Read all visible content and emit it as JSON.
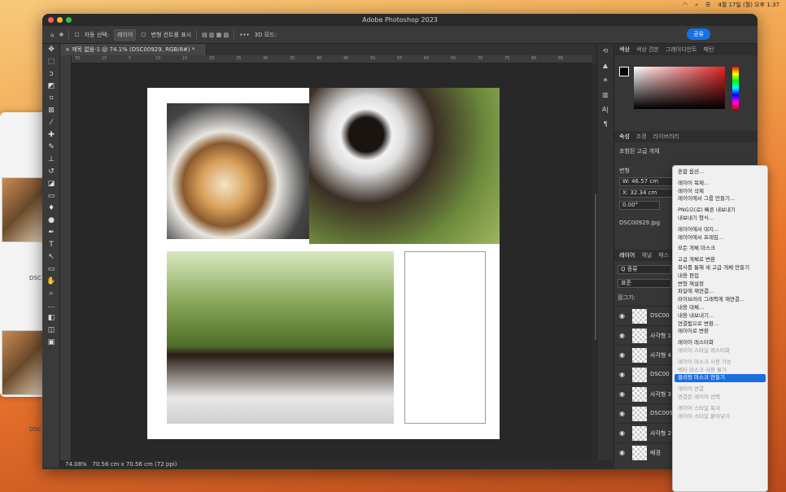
{
  "menubar": {
    "datetime": "4월 17일 (월) 오후 1:37"
  },
  "bg_window": {
    "label1": "DSC",
    "label2": "DSC"
  },
  "app": {
    "title": "Adobe Photoshop 2023"
  },
  "options": {
    "auto_select": "자동 선택:",
    "layer_chip": "레이어",
    "show_transform": "변형 컨트롤 표시",
    "mode3d": "3D 모드:",
    "share": "공유"
  },
  "document": {
    "tab": "제목 없음-1 @ 74.1% (DSC00929, RGB/8#) *"
  },
  "status": {
    "zoom": "74.08%",
    "size": "70.56 cm x 70.56 cm (72 ppi)"
  },
  "ruler_ticks": [
    "70",
    "15",
    "5",
    "10",
    "15",
    "20",
    "25",
    "30",
    "35",
    "40",
    "45",
    "50",
    "55",
    "60",
    "65",
    "70",
    "75",
    "80",
    "85"
  ],
  "panel": {
    "color_tabs": [
      "색상",
      "색상 견본",
      "그레이디언트",
      "패턴"
    ],
    "props_tabs": [
      "속성",
      "조정",
      "라이브러리"
    ],
    "smart_obj": "포함된 고급 개체",
    "transform": "변형",
    "w": "W: 46.57 cm",
    "x": "X: 32.34 cm",
    "angle": "0.00°",
    "file": "DSC00929.jpg",
    "layer_tabs": [
      "레이어",
      "채널",
      "패스"
    ],
    "kind": "Q 종류",
    "blend": "표준",
    "lock": "잠그기:"
  },
  "layers": [
    {
      "name": "DSC00"
    },
    {
      "name": "사각형 1"
    },
    {
      "name": "사각형 4"
    },
    {
      "name": "DSC00"
    },
    {
      "name": "사각형 3"
    },
    {
      "name": "DSC0092"
    },
    {
      "name": "사각형 2"
    },
    {
      "name": "배경"
    }
  ],
  "context_menu": [
    {
      "label": "혼합 옵션...",
      "state": "normal"
    },
    {
      "label": "",
      "state": "gap"
    },
    {
      "label": "레이어 복제...",
      "state": "normal"
    },
    {
      "label": "레이어 삭제",
      "state": "normal"
    },
    {
      "label": "레이어에서 그룹 만들기...",
      "state": "normal"
    },
    {
      "label": "",
      "state": "gap"
    },
    {
      "label": "PNG으(로) 빠른 내보내기",
      "state": "normal"
    },
    {
      "label": "내보내기 형식...",
      "state": "normal"
    },
    {
      "label": "",
      "state": "gap"
    },
    {
      "label": "레이어에서 대지...",
      "state": "normal"
    },
    {
      "label": "레이어에서 프레임...",
      "state": "normal"
    },
    {
      "label": "",
      "state": "gap"
    },
    {
      "label": "모든 개체 마스크",
      "state": "normal"
    },
    {
      "label": "",
      "state": "gap"
    },
    {
      "label": "고급 개체로 변환",
      "state": "normal"
    },
    {
      "label": "복사를 통해 새 고급 개체 만들기",
      "state": "normal"
    },
    {
      "label": "내용 편집",
      "state": "normal"
    },
    {
      "label": "변형 재설정",
      "state": "normal"
    },
    {
      "label": "파일에 재연결...",
      "state": "normal"
    },
    {
      "label": "라이브러리 그래픽에 재연결...",
      "state": "normal"
    },
    {
      "label": "내용 대체...",
      "state": "normal"
    },
    {
      "label": "내용 내보내기...",
      "state": "normal"
    },
    {
      "label": "연결됨으로 변환...",
      "state": "normal"
    },
    {
      "label": "레이어로 변환",
      "state": "normal"
    },
    {
      "label": "",
      "state": "gap"
    },
    {
      "label": "레이어 래스터화",
      "state": "normal"
    },
    {
      "label": "레이어 스타일 래스터화",
      "state": "disabled"
    },
    {
      "label": "",
      "state": "gap"
    },
    {
      "label": "레이어 마스크 사용 가능",
      "state": "disabled"
    },
    {
      "label": "벡터 마스크 사용 불가",
      "state": "disabled"
    },
    {
      "label": "클리핑 마스크 만들기",
      "state": "highlight"
    },
    {
      "label": "",
      "state": "gap"
    },
    {
      "label": "레이어 연결",
      "state": "disabled"
    },
    {
      "label": "연결된 레이어 선택",
      "state": "disabled"
    },
    {
      "label": "",
      "state": "gap"
    },
    {
      "label": "레이어 스타일 복사",
      "state": "disabled"
    },
    {
      "label": "레이어 스타일 붙여넣기",
      "state": "disabled"
    }
  ]
}
